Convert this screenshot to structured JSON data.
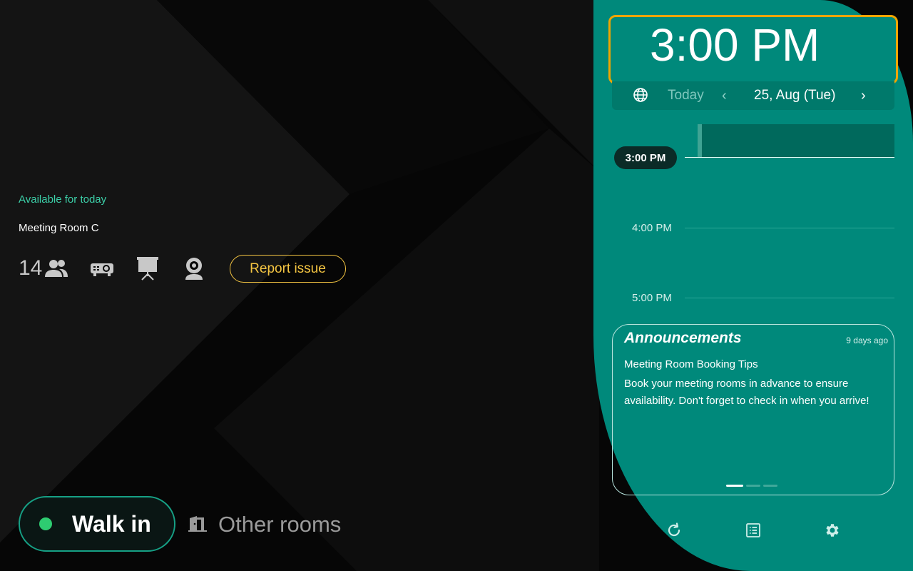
{
  "room": {
    "status": "Available for today",
    "name": "Meeting Room C",
    "capacity": "14",
    "amenities": [
      "people-icon",
      "projector-icon",
      "presentation-board-icon",
      "webcam-icon"
    ],
    "report_label": "Report issue"
  },
  "actions": {
    "walk_in_label": "Walk in",
    "other_rooms_label": "Other rooms"
  },
  "clock": {
    "time": "3:00 PM"
  },
  "date_nav": {
    "today_label": "Today",
    "prev": "‹",
    "date": "25, Aug (Tue)",
    "next": "›"
  },
  "timeline": {
    "current_time": "3:00 PM",
    "hours": [
      "4:00 PM",
      "5:00 PM"
    ]
  },
  "announcements": {
    "title": "Announcements",
    "age": "9 days ago",
    "heading": "Meeting Room Booking Tips",
    "body": "Book your meeting rooms in advance to ensure availability. Don't forget to check in when you arrive!",
    "pages": 3,
    "active_page": 1
  },
  "footer": {
    "icons": [
      "refresh-icon",
      "list-icon",
      "settings-icon"
    ]
  },
  "colors": {
    "panel": "#00897b",
    "accent_yellow": "#f4c542",
    "available_green": "#3ccfa8",
    "clock_border": "#f0a500"
  }
}
